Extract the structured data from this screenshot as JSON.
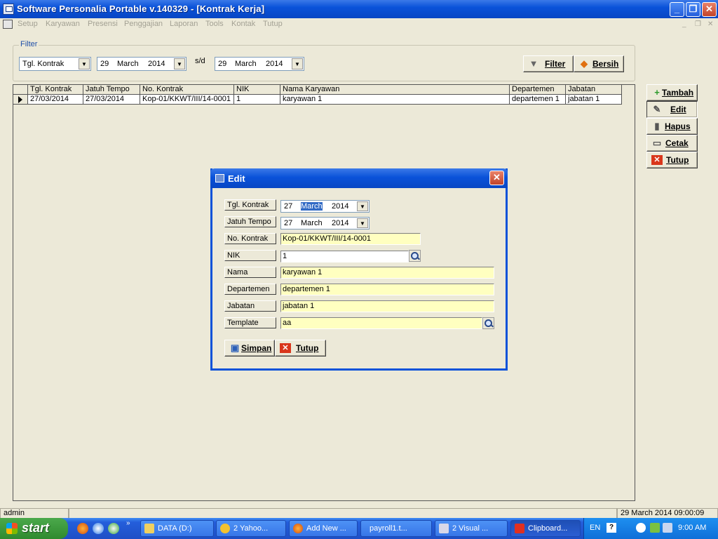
{
  "window": {
    "title": "Software Personalia Portable v.140329 - [Kontrak Kerja]",
    "minimize": "_",
    "restore": "❐",
    "close": "✕"
  },
  "menu": {
    "items": [
      "Setup",
      "Karyawan",
      "Presensi",
      "Penggajian",
      "Laporan",
      "Tools",
      "Kontak",
      "Tutup"
    ],
    "mdi_min": "_",
    "mdi_restore": "❐",
    "mdi_close": "✕"
  },
  "filter": {
    "legend": "Filter",
    "field": "Tgl. Kontrak",
    "from": {
      "day": "29",
      "month": "March",
      "year": "2014"
    },
    "separator": "s/d",
    "to": {
      "day": "29",
      "month": "March",
      "year": "2014"
    },
    "filter_label": "Filter",
    "clear_label": "Bersih"
  },
  "grid": {
    "columns": [
      "Tgl. Kontrak",
      "Jatuh Tempo",
      "No. Kontrak",
      "NIK",
      "Nama Karyawan",
      "Departemen",
      "Jabatan"
    ],
    "rows": [
      [
        "27/03/2014",
        "27/03/2014",
        "Kop-01/KKWT/III/14-0001",
        "1",
        "karyawan 1",
        "departemen 1",
        "jabatan 1"
      ]
    ]
  },
  "actions": {
    "add": "Tambah",
    "edit": "Edit",
    "delete": "Hapus",
    "print": "Cetak",
    "close": "Tutup"
  },
  "dialog": {
    "title": "Edit",
    "close": "✕",
    "fields": {
      "tgl_kontrak_label": "Tgl. Kontrak",
      "tgl_kontrak": {
        "day": "27",
        "month": "March",
        "year": "2014"
      },
      "jatuh_tempo_label": "Jatuh Tempo",
      "jatuh_tempo": {
        "day": "27",
        "month": "March",
        "year": "2014"
      },
      "no_kontrak_label": "No. Kontrak",
      "no_kontrak": "Kop-01/KKWT/III/14-0001",
      "nik_label": "NIK",
      "nik": "1",
      "nama_label": "Nama",
      "nama": "karyawan 1",
      "departemen_label": "Departemen",
      "departemen": "departemen 1",
      "jabatan_label": "Jabatan",
      "jabatan": "jabatan 1",
      "template_label": "Template",
      "template": "aa"
    },
    "save_label": "Simpan",
    "close_label": "Tutup"
  },
  "status": {
    "user": "admin",
    "datetime": "29 March 2014  09:00:09"
  },
  "taskbar": {
    "start": "start",
    "tasks": [
      "DATA (D:)",
      "2 Yahoo...",
      "Add New ...",
      "payroll1.t...",
      "2 Visual ...",
      "Clipboard..."
    ],
    "tray_lang": "EN",
    "tray_help": "?",
    "clock": "9:00 AM"
  },
  "colors": {
    "title_blue": "#0a52d9",
    "input_yellow": "#ffffc0",
    "selection": "#316ac5",
    "start_green": "#2f8a2f"
  }
}
